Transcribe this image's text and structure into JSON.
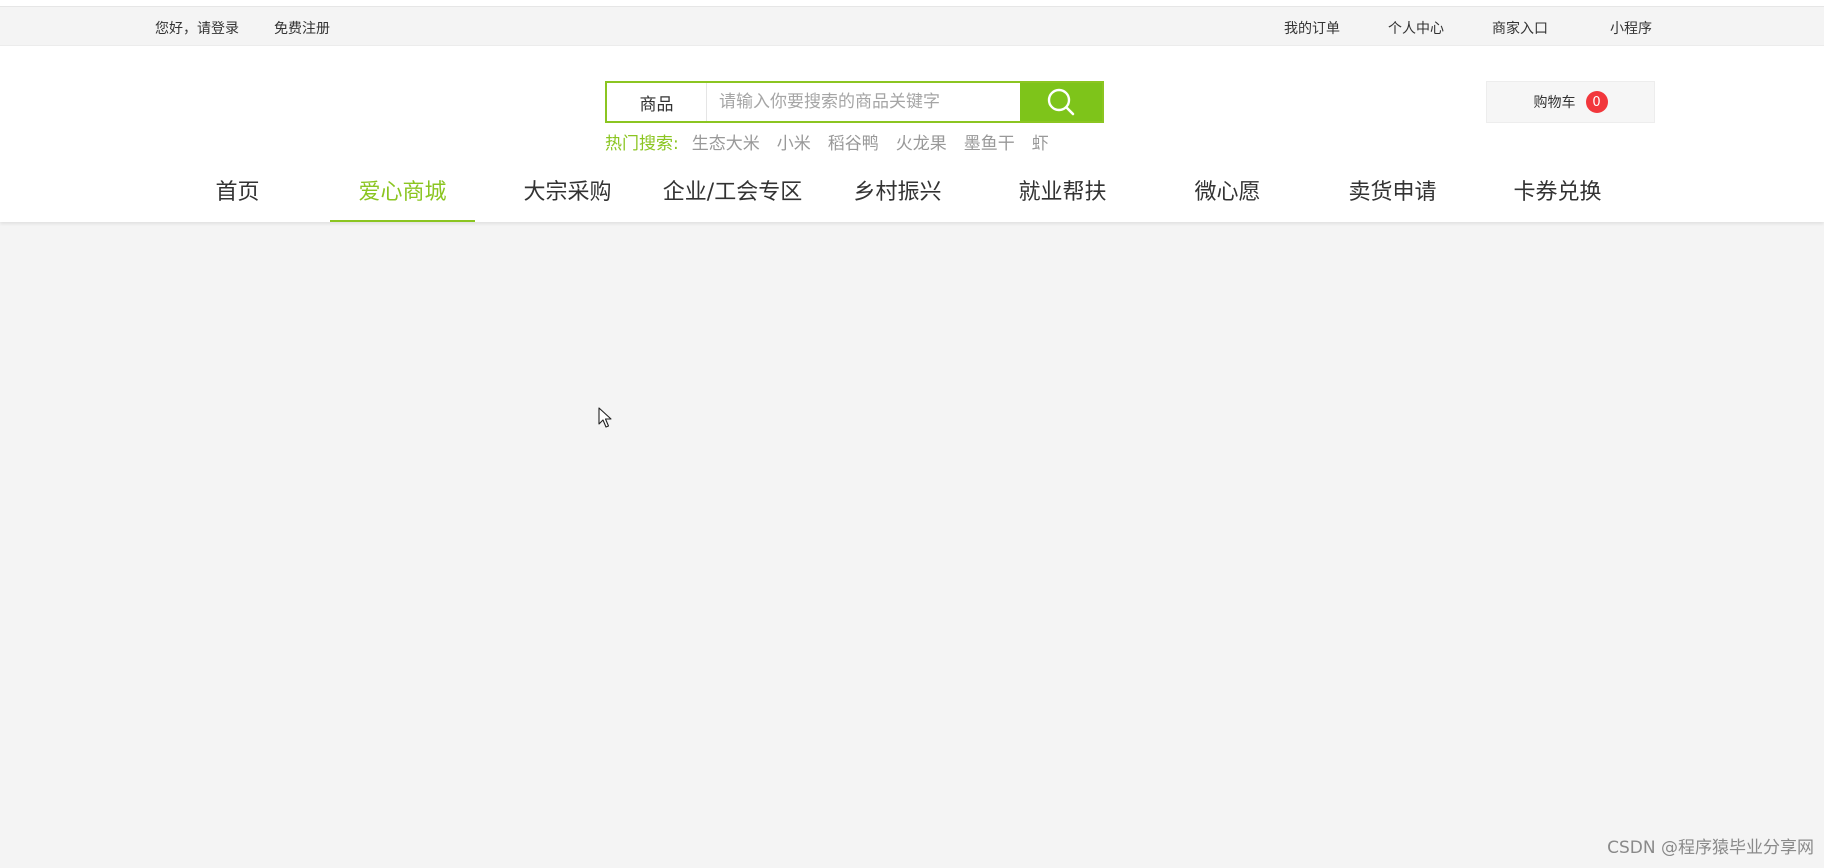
{
  "topbar": {
    "greeting": "您好，请登录",
    "register": "免费注册",
    "my_orders": "我的订单",
    "personal_center": "个人中心",
    "merchant_entry": "商家入口",
    "mini_program": "小程序"
  },
  "search": {
    "type_label": "商品",
    "placeholder": "请输入你要搜索的商品关键字",
    "value": "",
    "button_icon": "search-icon"
  },
  "hot_search": {
    "label": "热门搜索:",
    "terms": [
      "生态大米",
      "小米",
      "稻谷鸭",
      "火龙果",
      "墨鱼干",
      "虾"
    ]
  },
  "cart": {
    "label": "购物车",
    "count": "0"
  },
  "nav": {
    "items": [
      "首页",
      "爱心商城",
      "大宗采购",
      "企业/工会专区",
      "乡村振兴",
      "就业帮扶",
      "微心愿",
      "卖货申请",
      "卡券兑换"
    ],
    "active_index": 1
  },
  "watermark": "CSDN @程序猿毕业分享网",
  "colors": {
    "accent": "#8bc521",
    "search_button": "#7ec41a",
    "badge": "#f2373c",
    "page_bg": "#f4f4f4"
  }
}
